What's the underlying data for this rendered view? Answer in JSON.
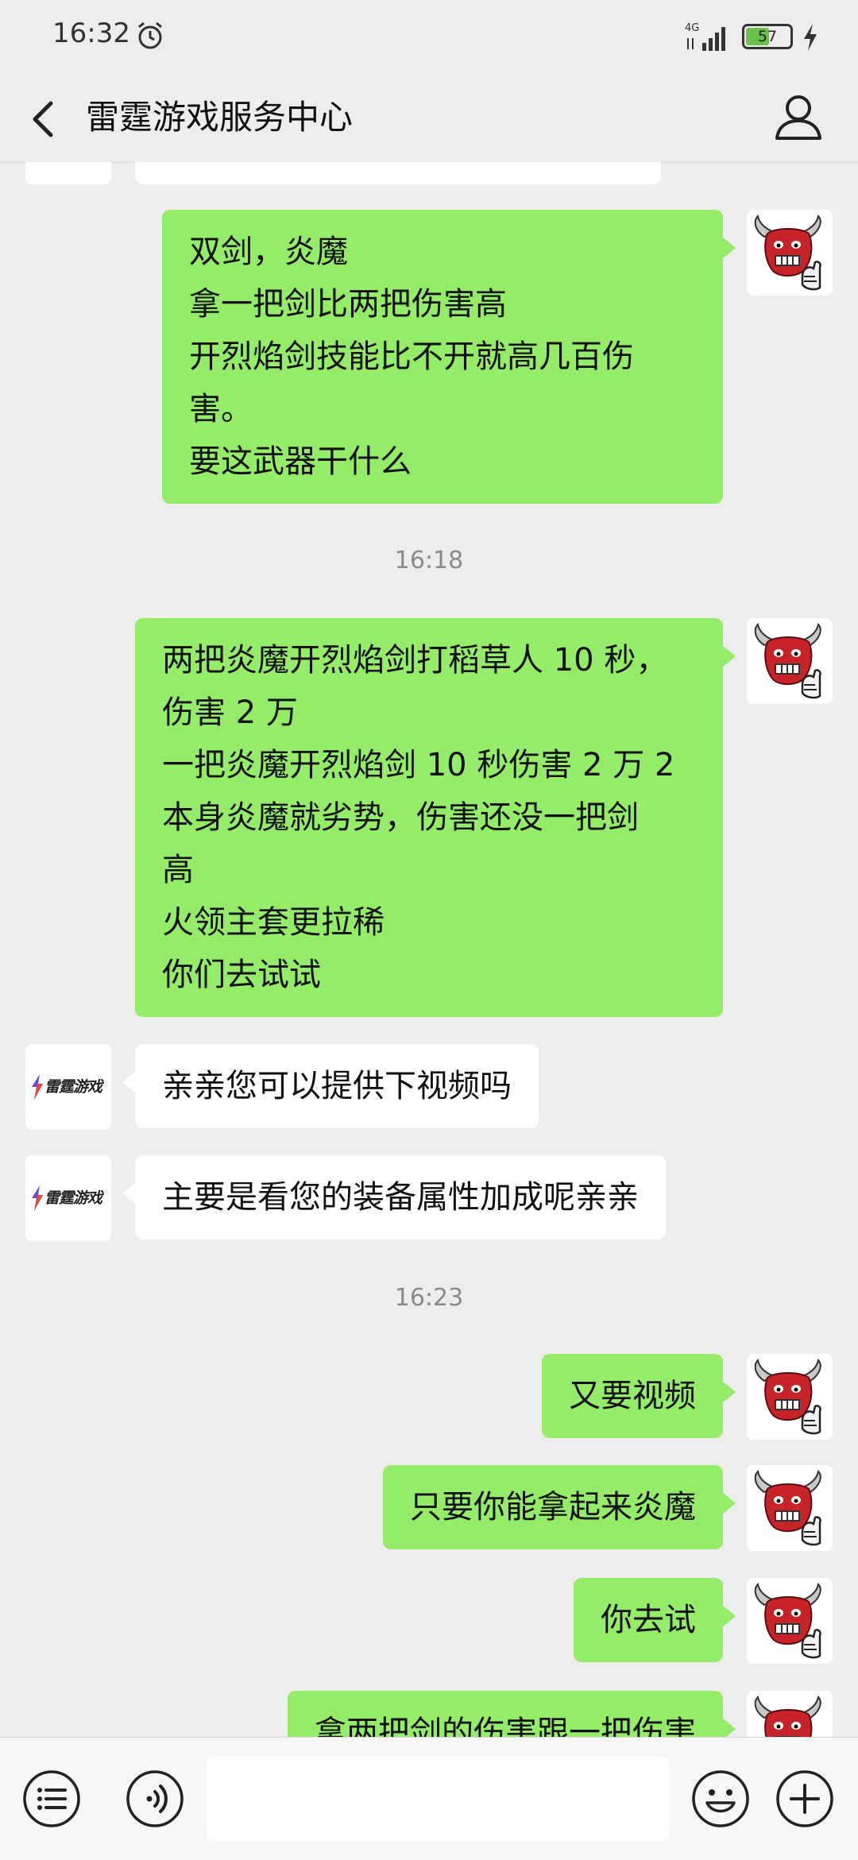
{
  "status_bar": {
    "time": "16:32",
    "network": "4G",
    "battery": "57",
    "battery_level": 0.57,
    "icons": [
      "alarm-icon",
      "signal-icon",
      "battery-icon",
      "charging-bolt-icon"
    ]
  },
  "header": {
    "title": "雷霆游戏服务中心",
    "icons": [
      "back-arrow-icon",
      "profile-icon"
    ]
  },
  "messages": [
    {
      "sender": "me",
      "text": "双剑，炎魔\n拿一把剑比两把伤害高\n开烈焰剑技能比不开就高几百伤\n害。\n要这武器干什么"
    },
    {
      "type": "timestamp",
      "text": "16:18"
    },
    {
      "sender": "me",
      "text": "两把炎魔开烈焰剑打稻草人 10 秒，\n伤害 2 万\n一把炎魔开烈焰剑 10 秒伤害 2 万 2\n本身炎魔就劣势，伤害还没一把剑\n高\n火领主套更拉稀\n你们去试试"
    },
    {
      "sender": "service",
      "text": "亲亲您可以提供下视频吗"
    },
    {
      "sender": "service",
      "text": "主要是看您的装备属性加成呢亲亲"
    },
    {
      "type": "timestamp",
      "text": "16:23"
    },
    {
      "sender": "me",
      "text": "又要视频"
    },
    {
      "sender": "me",
      "text": "只要你能拿起来炎魔"
    },
    {
      "sender": "me",
      "text": "你去试"
    },
    {
      "sender": "me",
      "text": "拿两把剑的伤害跟一把伤害"
    }
  ],
  "service_logo_text": "雷霆游戏",
  "input_bar": {
    "icons": [
      "menu-list-icon",
      "voice-icon",
      "emoji-icon",
      "plus-icon"
    ],
    "text": ""
  },
  "colors": {
    "background": "#ededed",
    "outgoing_bubble": "#95ec69",
    "incoming_bubble": "#ffffff",
    "timestamp_text": "#8a8a8a"
  }
}
